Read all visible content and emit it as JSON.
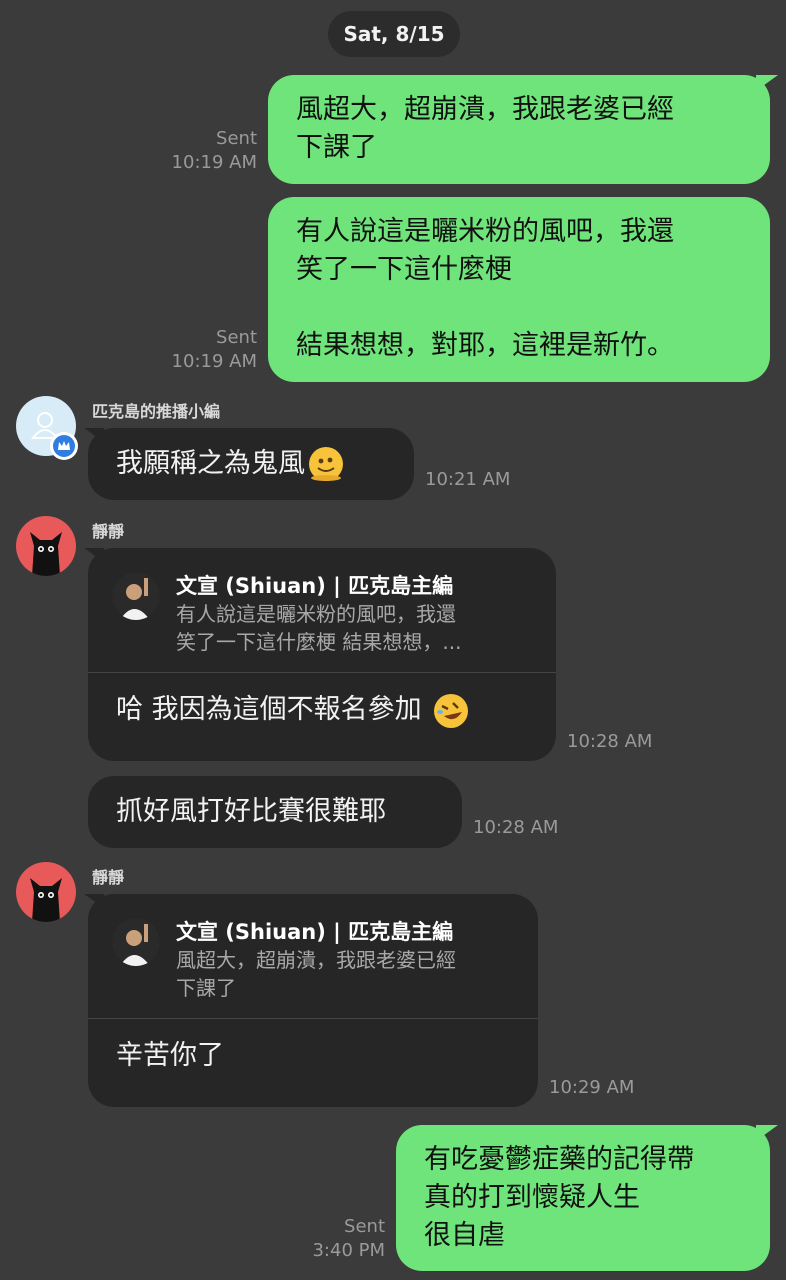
{
  "date_label": "Sat, 8/15",
  "messages": [
    {
      "lines": [
        "風超大，超崩潰，我跟老婆已經",
        "下課了"
      ],
      "status": "Sent",
      "time": "10:19 AM"
    },
    {
      "lines": [
        "有人說這是曬米粉的風吧，我還",
        "笑了一下這什麼梗",
        "",
        "結果想想，對耶，這裡是新竹。"
      ],
      "status": "Sent",
      "time": "10:19 AM"
    },
    {
      "sender": "匹克島的推播小編",
      "text": "我願稱之為鬼風",
      "emoji": "melting-face",
      "time": "10:21 AM"
    },
    {
      "sender": "靜靜",
      "reply_to": {
        "name": "文宣 (Shiuan) | 匹克島主編",
        "lines": [
          "有人說這是曬米粉的風吧，我還",
          "笑了一下這什麼梗 結果想想，..."
        ]
      },
      "text": "哈  我因為這個不報名參加",
      "emoji": "rolling-on-floor-laughing",
      "time": "10:28 AM"
    },
    {
      "text": "抓好風打好比賽很難耶",
      "time": "10:28 AM"
    },
    {
      "sender": "靜靜",
      "reply_to": {
        "name": "文宣 (Shiuan) | 匹克島主編",
        "lines": [
          "風超大，超崩潰，我跟老婆已經",
          "下課了"
        ]
      },
      "text": "辛苦你了",
      "time": "10:29 AM"
    },
    {
      "lines": [
        "有吃憂鬱症藥的記得帶",
        "真的打到懷疑人生",
        "很自虐"
      ],
      "status": "Sent",
      "time": "3:40 PM"
    }
  ],
  "colors": {
    "background": "#3b3b3b",
    "sent_bubble": "#6ee47a",
    "received_bubble": "#262626"
  }
}
